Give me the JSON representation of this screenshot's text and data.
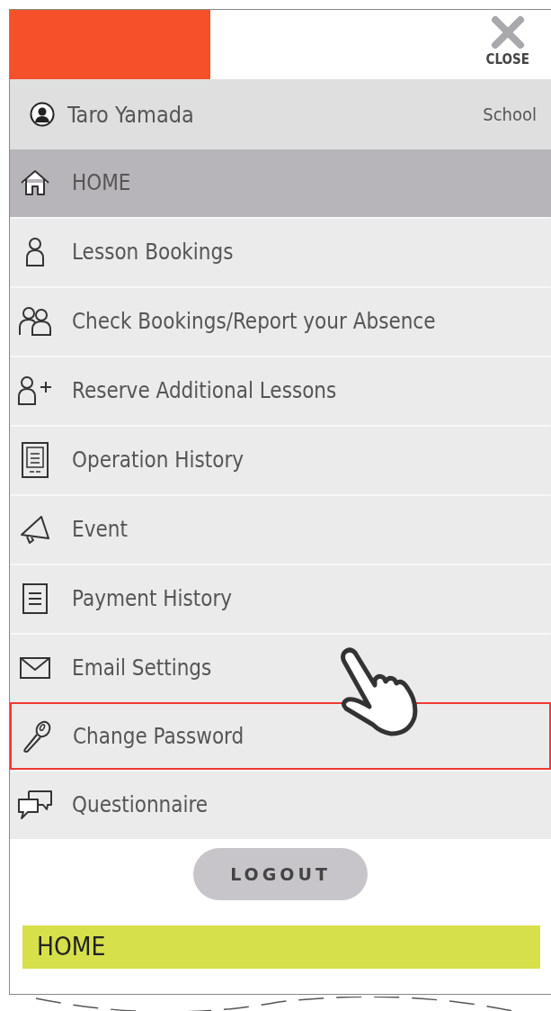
{
  "header": {
    "close_label": "CLOSE"
  },
  "user": {
    "name": "Taro Yamada",
    "school": "School"
  },
  "menu": [
    {
      "label": "HOME",
      "selected": true,
      "highlighted": false
    },
    {
      "label": "Lesson Bookings",
      "selected": false,
      "highlighted": false
    },
    {
      "label": "Check Bookings/Report your Absence",
      "selected": false,
      "highlighted": false
    },
    {
      "label": "Reserve Additional Lessons",
      "selected": false,
      "highlighted": false
    },
    {
      "label": "Operation History",
      "selected": false,
      "highlighted": false
    },
    {
      "label": "Event",
      "selected": false,
      "highlighted": false
    },
    {
      "label": "Payment History",
      "selected": false,
      "highlighted": false
    },
    {
      "label": "Email Settings",
      "selected": false,
      "highlighted": false
    },
    {
      "label": "Change Password",
      "selected": false,
      "highlighted": true
    },
    {
      "label": "Questionnaire",
      "selected": false,
      "highlighted": false
    }
  ],
  "logout_button": "LOGOUT",
  "page_banner": "HOME"
}
